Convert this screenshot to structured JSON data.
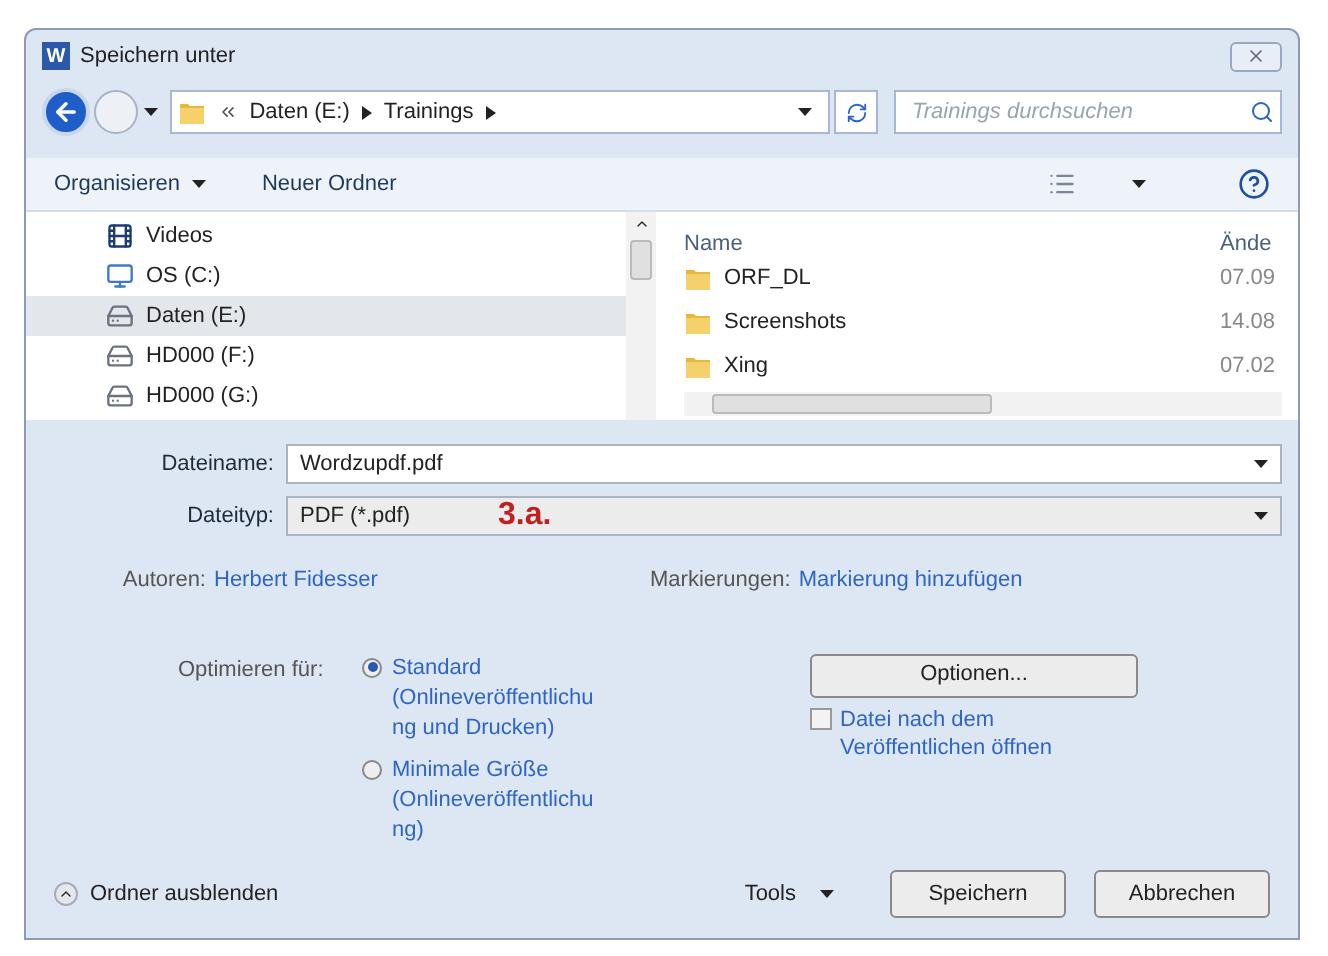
{
  "window": {
    "title": "Speichern unter",
    "icon_text": "W"
  },
  "address": {
    "crumbs": [
      "Daten (E:)",
      "Trainings"
    ]
  },
  "search": {
    "placeholder": "Trainings durchsuchen"
  },
  "toolbar": {
    "buttons": [
      {
        "label": "Organisieren",
        "dropdown": true
      },
      {
        "label": "Neuer Ordner",
        "dropdown": false
      }
    ]
  },
  "nav_tree": [
    {
      "label": "Videos",
      "kind": "video",
      "selected": false
    },
    {
      "label": "OS (C:)",
      "kind": "system",
      "selected": false
    },
    {
      "label": "Daten (E:)",
      "kind": "drive",
      "selected": true
    },
    {
      "label": "HD000 (F:)",
      "kind": "drive",
      "selected": false
    },
    {
      "label": "HD000 (G:)",
      "kind": "drive",
      "selected": false
    }
  ],
  "file_list": {
    "columns": [
      "Name",
      "Ände"
    ],
    "rows": [
      {
        "name": "ORF_DL",
        "column_2": "07.09"
      },
      {
        "name": "Screenshots",
        "column_2": "14.08"
      },
      {
        "name": "Xing",
        "column_2": "07.02"
      }
    ]
  },
  "fields": [
    {
      "label": "Dateiname:",
      "value": "Wordzupdf.pdf",
      "kind": "combo"
    },
    {
      "label": "Dateityp:",
      "value": "PDF (*.pdf)",
      "kind": "select",
      "annotation": "3.a."
    }
  ],
  "meta": {
    "authors_label": "Autoren:",
    "authors": "Herbert Fidesser",
    "tags_label": "Markierungen:",
    "tags": "Markierung hinzufügen"
  },
  "optimize": {
    "label": "Optimieren für:",
    "options": [
      {
        "lines": [
          "Standard",
          "(Onlineveröffentlichu",
          "ng und Drucken)"
        ],
        "selected": true
      },
      {
        "lines": [
          "Minimale Größe",
          "(Onlineveröffentlichu",
          "ng)"
        ],
        "selected": false
      }
    ]
  },
  "options_button": "Optionen...",
  "open_after": {
    "lines": [
      "Datei nach dem",
      "Veröffentlichen öffnen"
    ],
    "checked": false
  },
  "footer": {
    "hide_folders": "Ordner ausblenden",
    "tools": "Tools",
    "buttons": [
      "Speichern",
      "Abbrechen"
    ]
  }
}
